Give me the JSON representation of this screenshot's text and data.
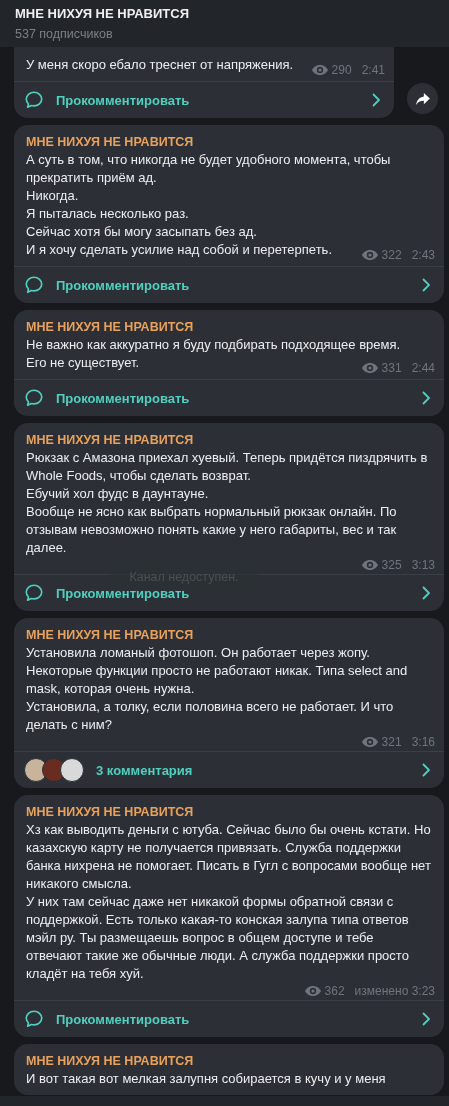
{
  "header": {
    "title": "МНЕ НИХУЯ НЕ НРАВИТСЯ",
    "subtitle": "537 подписчиков"
  },
  "messages": [
    {
      "lines": [
        "У меня скоро ебало треснет от напряжения."
      ],
      "views": "290",
      "time": "2:41",
      "forward": true,
      "comments": {
        "kind": "button",
        "label": "Прокомментировать"
      }
    },
    {
      "author": "МНЕ НИХУЯ НЕ НРАВИТСЯ",
      "lines": [
        "А суть в том, что никогда не будет удобного момента, чтобы прекратить приём ад.",
        "Никогда.",
        "Я пыталась несколько раз.",
        "Сейчас хотя бы могу засыпать без ад.",
        "И я хочу сделать усилие над собой и перетерпеть."
      ],
      "views": "322",
      "time": "2:43",
      "forward": false,
      "comments": {
        "kind": "button",
        "label": "Прокомментировать"
      }
    },
    {
      "author": "МНЕ НИХУЯ НЕ НРАВИТСЯ",
      "lines": [
        "Не важно как аккуратно я буду подбирать подходящее время.",
        "Его не существует."
      ],
      "views": "331",
      "time": "2:44",
      "forward": false,
      "comments": {
        "kind": "button",
        "label": "Прокомментировать"
      }
    },
    {
      "author": "МНЕ НИХУЯ НЕ НРАВИТСЯ",
      "lines": [
        "Рюкзак с Амазона приехал хуевый. Теперь придётся пиздрячить в Whole Foods, чтобы сделать возврат.",
        "Ебучий хол фудс в даунтауне.",
        "Вообще не ясно как выбрать нормальный рюкзак онлайн. По отзывам невозможно понять какие у него габариты, вес и так далее."
      ],
      "views": "325",
      "time": "3:13",
      "toast": "Канал недоступен.",
      "forward": false,
      "comments": {
        "kind": "button",
        "label": "Прокомментировать"
      }
    },
    {
      "author": "МНЕ НИХУЯ НЕ НРАВИТСЯ",
      "lines": [
        "Установила ломаный фотошоп. Он работает через жопу.",
        "Некоторые функции просто не работают никак. Типа select and mask, которая очень нужна.",
        "Установила, а толку, если половина всего не работает. И что делать с ним?"
      ],
      "views": "321",
      "time": "3:16",
      "forward": false,
      "comments": {
        "kind": "avatars",
        "label": "3 комментария",
        "avatars": [
          {
            "color": "#c8b49a"
          },
          {
            "color": "#6a2b20"
          },
          {
            "color": "#d9d9d9"
          }
        ]
      }
    },
    {
      "author": "МНЕ НИХУЯ НЕ НРАВИТСЯ",
      "lines": [
        "Хз как выводить деньги с ютуба. Сейчас было бы очень кстати. Но казахскую карту не получается привязать. Служба поддержки банка нихрена не помогает. Писать в Гугл с вопросами вообще нет никакого смысла.",
        "У них там сейчас даже нет никакой формы обратной связи с поддержкой. Есть только какая-то конская залупа типа ответов мэйл ру. Ты размещаешь вопрос в общем доступе и тебе отвечают такие же обычные люди. А служба поддержки просто кладёт на тебя хуй."
      ],
      "views": "362",
      "time": "изменено 3:23",
      "forward": false,
      "comments": {
        "kind": "button",
        "label": "Прокомментировать"
      }
    },
    {
      "author": "МНЕ НИХУЯ НЕ НРАВИТСЯ",
      "lines": [
        "И вот такая вот мелкая залупня собирается в кучу и у меня"
      ]
    }
  ]
}
